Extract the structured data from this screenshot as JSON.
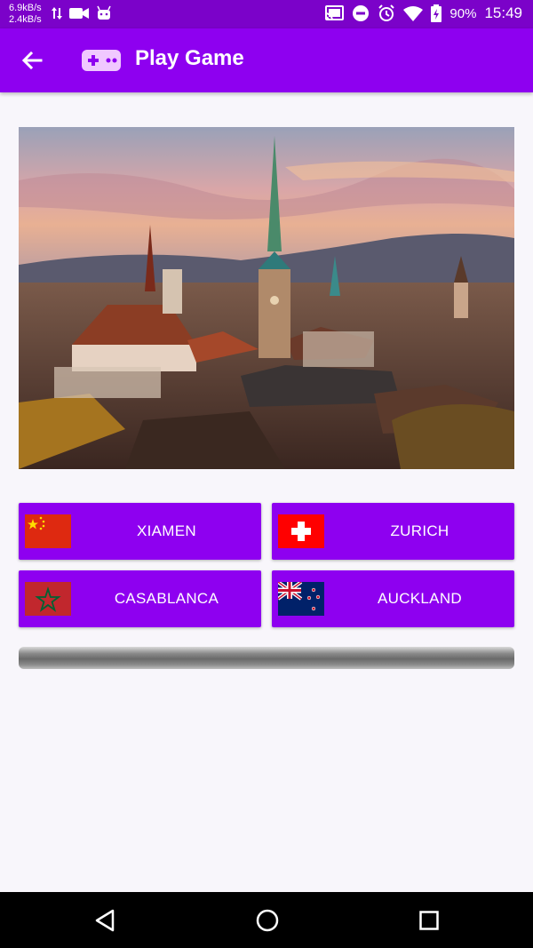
{
  "status_bar": {
    "net_down": "6.9kB/s",
    "net_up": "2.4kB/s",
    "battery": "90%",
    "time": "15:49",
    "icons": [
      "data-arrows-icon",
      "video-camera-icon",
      "android-icon",
      "cast-icon",
      "dnd-icon",
      "alarm-icon",
      "wifi-icon",
      "battery-icon"
    ]
  },
  "app_bar": {
    "title": "Play Game",
    "back_icon": "arrow-back-icon",
    "game_icon": "gamepad-icon",
    "background": "#8e00f0"
  },
  "hero": {
    "subject": "city-skyline-photo"
  },
  "options": [
    {
      "label": "XIAMEN",
      "flag": "china-flag"
    },
    {
      "label": "ZURICH",
      "flag": "switzerland-flag"
    },
    {
      "label": "CASABLANCA",
      "flag": "morocco-flag"
    },
    {
      "label": "AUCKLAND",
      "flag": "new-zealand-flag"
    }
  ],
  "progress": {
    "value": 0
  },
  "nav_bar": {
    "icons": [
      "nav-back-icon",
      "nav-home-icon",
      "nav-recents-icon"
    ]
  }
}
